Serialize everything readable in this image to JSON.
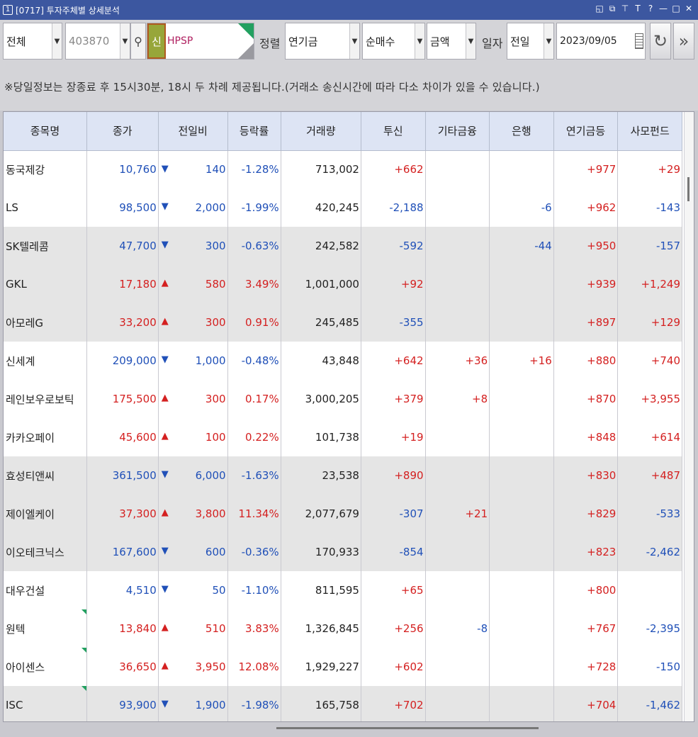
{
  "window": {
    "number": "1",
    "title": "[0717] 투자주체별 상세분석"
  },
  "toolbar": {
    "market_select": "전체",
    "code_value": "403870",
    "new_badge": "신",
    "stock_name": "HPSP",
    "sort_label": "정렬",
    "investor_select": "연기금",
    "type_select": "순매수",
    "unit_select": "금액",
    "date_label": "일자",
    "period_select": "전일",
    "date_value": "2023/09/05"
  },
  "notice": "※당일정보는 장종료 후 15시30분, 18시 두 차례 제공됩니다.(거래소 송신시간에 따라 다소 차이가 있을 수 있습니다.)",
  "table": {
    "headers": [
      "종목명",
      "종가",
      "전일비",
      "등락률",
      "거래량",
      "투신",
      "기타금융",
      "은행",
      "연기금등",
      "사모펀드"
    ],
    "rows": [
      {
        "name": "동국제강",
        "price": "10,760",
        "change": "140",
        "dir": "down",
        "rate": "-1.28%",
        "volume": "713,002",
        "trust": "+662",
        "finance": "",
        "bank": "",
        "pension": "+977",
        "private": "+29"
      },
      {
        "name": "LS",
        "price": "98,500",
        "change": "2,000",
        "dir": "down",
        "rate": "-1.99%",
        "volume": "420,245",
        "trust": "-2,188",
        "finance": "",
        "bank": "-6",
        "pension": "+962",
        "private": "-143"
      },
      {
        "name": "SK텔레콤",
        "price": "47,700",
        "change": "300",
        "dir": "down",
        "rate": "-0.63%",
        "volume": "242,582",
        "trust": "-592",
        "finance": "",
        "bank": "-44",
        "pension": "+950",
        "private": "-157"
      },
      {
        "name": "GKL",
        "price": "17,180",
        "change": "580",
        "dir": "up",
        "rate": "3.49%",
        "volume": "1,001,000",
        "trust": "+92",
        "finance": "",
        "bank": "",
        "pension": "+939",
        "private": "+1,249"
      },
      {
        "name": "아모레G",
        "price": "33,200",
        "change": "300",
        "dir": "up",
        "rate": "0.91%",
        "volume": "245,485",
        "trust": "-355",
        "finance": "",
        "bank": "",
        "pension": "+897",
        "private": "+129"
      },
      {
        "name": "신세계",
        "price": "209,000",
        "change": "1,000",
        "dir": "down",
        "rate": "-0.48%",
        "volume": "43,848",
        "trust": "+642",
        "finance": "+36",
        "bank": "+16",
        "pension": "+880",
        "private": "+740"
      },
      {
        "name": "레인보우로보틱",
        "price": "175,500",
        "change": "300",
        "dir": "up",
        "rate": "0.17%",
        "volume": "3,000,205",
        "trust": "+379",
        "finance": "+8",
        "bank": "",
        "pension": "+870",
        "private": "+3,955"
      },
      {
        "name": "카카오페이",
        "price": "45,600",
        "change": "100",
        "dir": "up",
        "rate": "0.22%",
        "volume": "101,738",
        "trust": "+19",
        "finance": "",
        "bank": "",
        "pension": "+848",
        "private": "+614"
      },
      {
        "name": "효성티앤씨",
        "price": "361,500",
        "change": "6,000",
        "dir": "down",
        "rate": "-1.63%",
        "volume": "23,538",
        "trust": "+890",
        "finance": "",
        "bank": "",
        "pension": "+830",
        "private": "+487"
      },
      {
        "name": "제이엘케이",
        "price": "37,300",
        "change": "3,800",
        "dir": "up",
        "rate": "11.34%",
        "volume": "2,077,679",
        "trust": "-307",
        "finance": "+21",
        "bank": "",
        "pension": "+829",
        "private": "-533"
      },
      {
        "name": "이오테크닉스",
        "price": "167,600",
        "change": "600",
        "dir": "down",
        "rate": "-0.36%",
        "volume": "170,933",
        "trust": "-854",
        "finance": "",
        "bank": "",
        "pension": "+823",
        "private": "-2,462"
      },
      {
        "name": "대우건설",
        "price": "4,510",
        "change": "50",
        "dir": "down",
        "rate": "-1.10%",
        "volume": "811,595",
        "trust": "+65",
        "finance": "",
        "bank": "",
        "pension": "+800",
        "private": ""
      },
      {
        "name": "원텍",
        "price": "13,840",
        "change": "510",
        "dir": "up",
        "rate": "3.83%",
        "volume": "1,326,845",
        "trust": "+256",
        "finance": "-8",
        "bank": "",
        "pension": "+767",
        "private": "-2,395"
      },
      {
        "name": "아이센스",
        "price": "36,650",
        "change": "3,950",
        "dir": "up",
        "rate": "12.08%",
        "volume": "1,929,227",
        "trust": "+602",
        "finance": "",
        "bank": "",
        "pension": "+728",
        "private": "-150"
      },
      {
        "name": "ISC",
        "price": "93,900",
        "change": "1,900",
        "dir": "down",
        "rate": "-1.98%",
        "volume": "165,758",
        "trust": "+702",
        "finance": "",
        "bank": "",
        "pension": "+704",
        "private": "-1,462"
      }
    ]
  },
  "colors": {
    "up": "#d42020",
    "down": "#2050b8",
    "title_bar": "#3c57a0",
    "header_bg": "#dde4f4",
    "shade": "#e5e5e5"
  },
  "icons": {
    "search": "magnifier-icon",
    "refresh": "refresh-icon",
    "next": "double-chevron-right-icon",
    "calendar": "calendar-icon"
  }
}
